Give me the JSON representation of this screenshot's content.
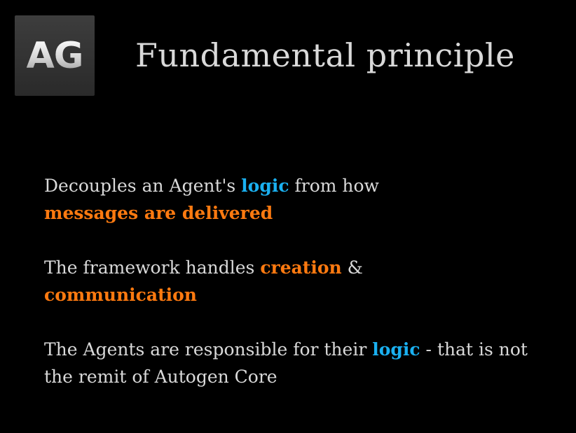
{
  "logo": {
    "text": "AG"
  },
  "title": "Fundamental principle",
  "paragraphs": [
    {
      "segments": [
        {
          "text": "Decouples an Agent's ",
          "style": "plain"
        },
        {
          "text": "logic",
          "style": "blue"
        },
        {
          "text": " from how ",
          "style": "plain"
        },
        {
          "text": "messages are delivered",
          "style": "orange"
        }
      ]
    },
    {
      "segments": [
        {
          "text": "The framework handles ",
          "style": "plain"
        },
        {
          "text": "creation",
          "style": "orange"
        },
        {
          "text": " & ",
          "style": "plain"
        },
        {
          "text": "communication",
          "style": "orange"
        }
      ]
    },
    {
      "segments": [
        {
          "text": "The Agents are responsible for their ",
          "style": "plain"
        },
        {
          "text": "logic",
          "style": "blue"
        },
        {
          "text": " - that is not the remit of Autogen Core",
          "style": "plain"
        }
      ]
    }
  ],
  "colors": {
    "background": "#000000",
    "text": "#d9d9d9",
    "highlight_blue": "#1ab0f0",
    "highlight_orange": "#ff7a10"
  }
}
